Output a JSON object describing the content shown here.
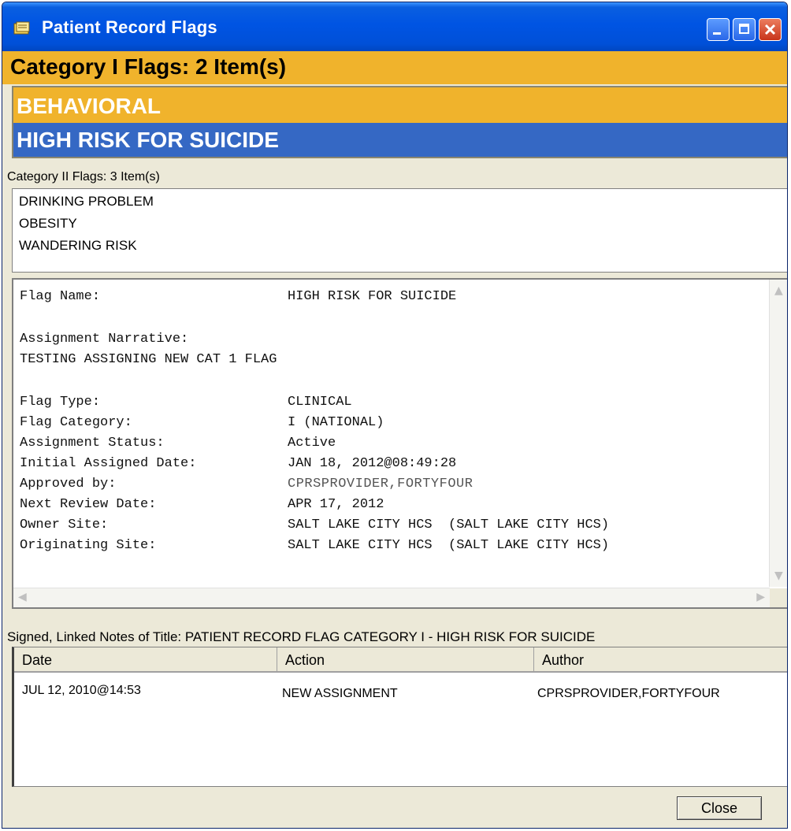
{
  "window": {
    "title": "Patient Record Flags"
  },
  "category1": {
    "header": "Category I Flags: 2 Item(s)",
    "items": [
      "BEHAVIORAL",
      "HIGH RISK FOR SUICIDE"
    ],
    "colors": {
      "header_bg": "#f0b32c",
      "selected_bg": "#3568c4"
    }
  },
  "category2": {
    "label": "Category II Flags: 3 Item(s)",
    "items": [
      "DRINKING PROBLEM",
      "OBESITY",
      "WANDERING RISK"
    ]
  },
  "details": {
    "flag_name_label": "Flag Name:",
    "flag_name_value": "HIGH RISK FOR SUICIDE",
    "narrative_label": "Assignment Narrative:",
    "narrative_value": "TESTING ASSIGNING NEW CAT 1 FLAG",
    "fields": [
      {
        "label": "Flag Type:",
        "value": "CLINICAL"
      },
      {
        "label": "Flag Category:",
        "value": "I (NATIONAL)"
      },
      {
        "label": "Assignment Status:",
        "value": "Active"
      },
      {
        "label": "Initial Assigned Date:",
        "value": "JAN 18, 2012@08:49:28"
      },
      {
        "label": "Approved by:",
        "value": "CPRSPROVIDER,FORTYFOUR"
      },
      {
        "label": "Next Review Date:",
        "value": "APR 17, 2012"
      },
      {
        "label": "Owner Site:",
        "value": "SALT LAKE CITY HCS  (SALT LAKE CITY HCS)"
      },
      {
        "label": "Originating Site:",
        "value": "SALT LAKE CITY HCS  (SALT LAKE CITY HCS)"
      }
    ]
  },
  "notes": {
    "label": "Signed, Linked Notes of Title: PATIENT RECORD FLAG CATEGORY I - HIGH RISK FOR SUICIDE",
    "columns": [
      "Date",
      "Action",
      "Author"
    ],
    "rows": [
      {
        "date": "JUL 12, 2010@14:53",
        "action": "NEW ASSIGNMENT",
        "author": "CPRSPROVIDER,FORTYFOUR"
      }
    ]
  },
  "buttons": {
    "close_label": "Close"
  }
}
